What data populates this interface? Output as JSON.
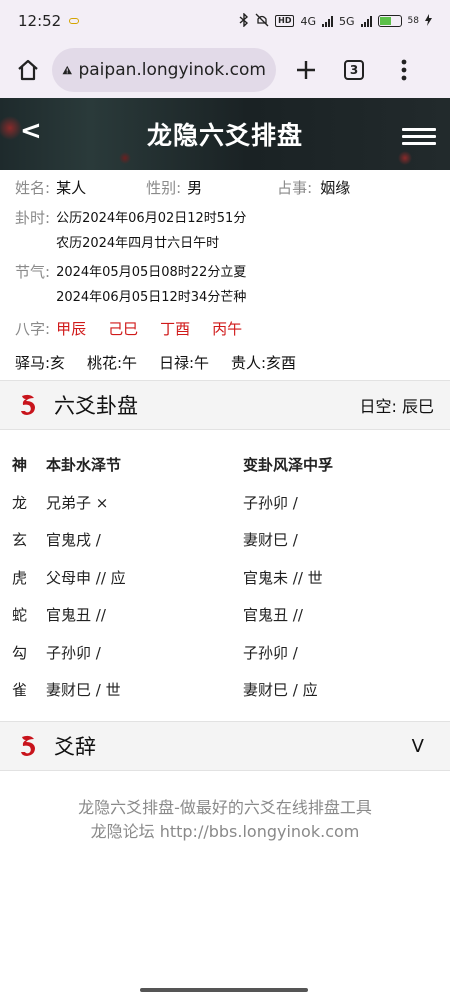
{
  "status": {
    "time": "12:52",
    "net1": "4G",
    "net2": "5G",
    "hd": "HD",
    "battery": "58"
  },
  "browser": {
    "url": "paipan.longyinok.com",
    "tab_count": "3"
  },
  "header": {
    "back": "<",
    "title": "龙隐六爻排盘"
  },
  "info": {
    "name_label": "姓名:",
    "name_value": "某人",
    "gender_label": "性别:",
    "gender_value": "男",
    "matter_label": "占事:",
    "matter_value": "姻缘",
    "time_label": "卦时:",
    "gregorian": "公历2024年06月02日12时51分",
    "lunar": "农历2024年四月廿六日午时",
    "solar_label": "节气:",
    "solar1": "2024年05月05日08时22分立夏",
    "solar2": "2024年06月05日12时34分芒种",
    "bazi_label": "八字:",
    "bazi": [
      "甲辰",
      "己巳",
      "丁酉",
      "丙午"
    ],
    "extra": [
      "驿马:亥",
      "桃花:午",
      "日禄:午",
      "贵人:亥酉"
    ]
  },
  "section1": {
    "title": "六爻卦盘",
    "right": "日空: 辰巳"
  },
  "hexagram": {
    "head": [
      "神",
      "本卦水泽节",
      "变卦风泽中孚"
    ],
    "rows": [
      [
        "龙",
        "兄弟子 ×",
        "子孙卯 /"
      ],
      [
        "玄",
        "官鬼戌 /",
        "妻财巳 /"
      ],
      [
        "虎",
        "父母申 // 应",
        "官鬼未 // 世"
      ],
      [
        "蛇",
        "官鬼丑 //",
        "官鬼丑 //"
      ],
      [
        "勾",
        "子孙卯 /",
        "子孙卯 /"
      ],
      [
        "雀",
        "妻财巳 / 世",
        "妻财巳 / 应"
      ]
    ]
  },
  "section2": {
    "title": "爻辞",
    "toggle": "V"
  },
  "footer": {
    "line1": "龙隐六爻排盘-做最好的六爻在线排盘工具",
    "line2": "龙隐论坛 http://bbs.longyinok.com"
  }
}
